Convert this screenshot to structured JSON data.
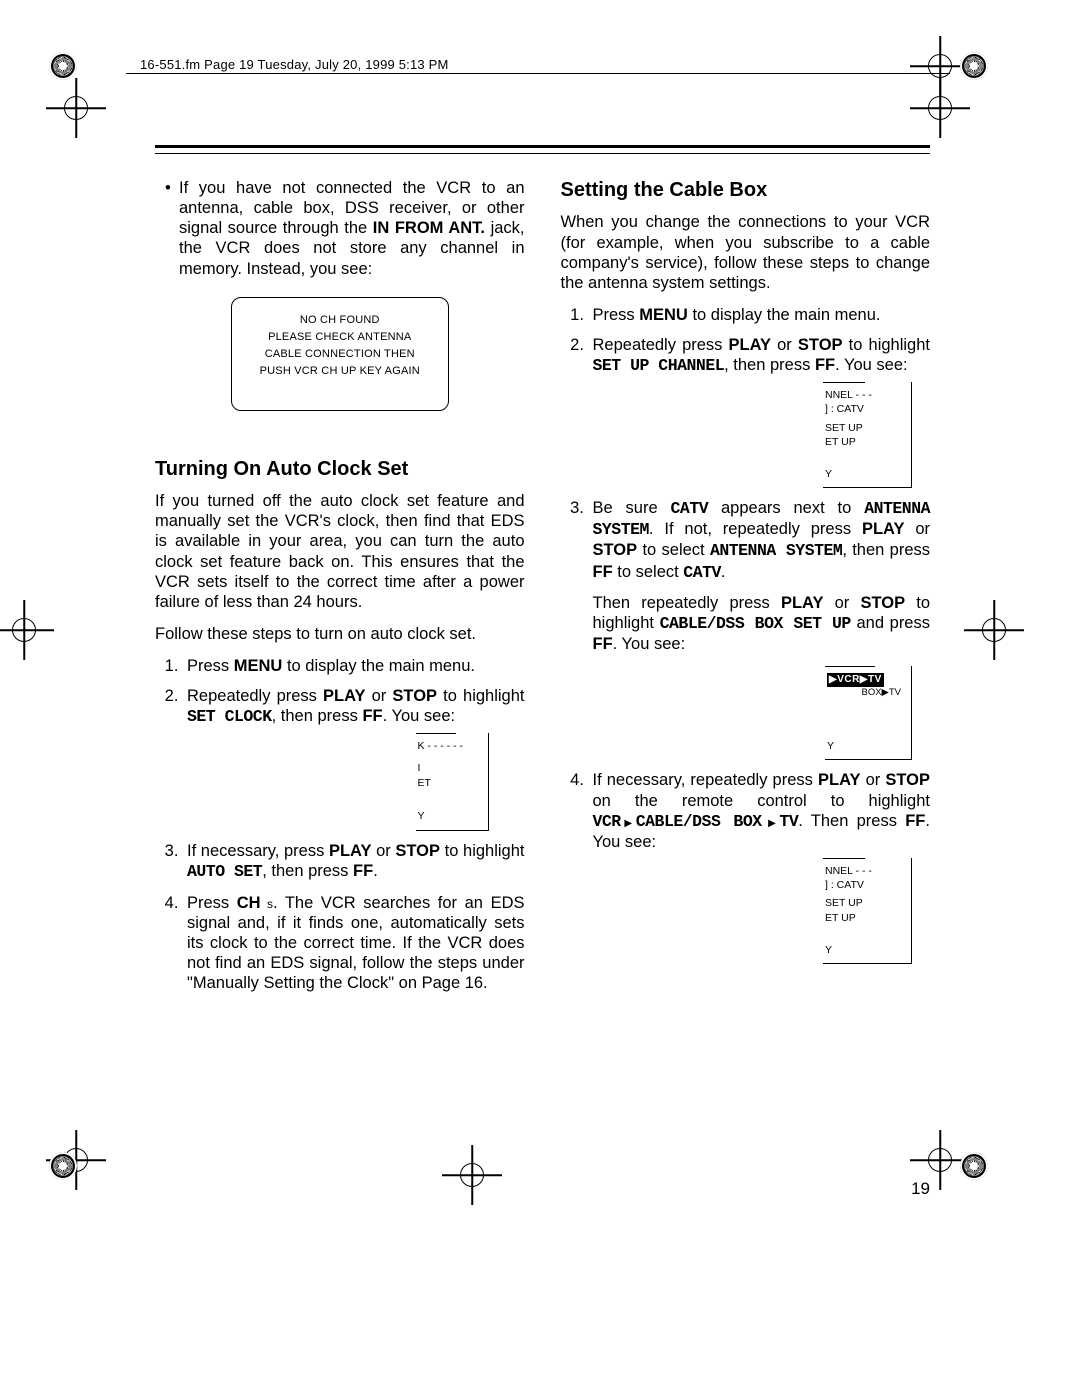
{
  "header": "16-551.fm  Page 19  Tuesday, July 20, 1999  5:13 PM",
  "page_number": "19",
  "left": {
    "bullet": {
      "pre": "If you have not connected the VCR to an antenna, cable box, DSS receiver, or other signal source through the ",
      "kw1": "IN FROM ANT.",
      "post": " jack, the VCR does not store any channel in memory. Instead, you see:"
    },
    "msgbox": {
      "l1": "NO CH FOUND",
      "l2": "PLEASE CHECK ANTENNA",
      "l3": "CABLE CONNECTION THEN",
      "l4": "PUSH VCR CH UP KEY AGAIN"
    },
    "h": "Turning On Auto Clock Set",
    "p1": "If you turned off the auto clock set feature and manually set the VCR's clock, then find that EDS is available in your area, you can turn the auto clock set feature back on. This ensures that the VCR sets itself to the correct time after a power failure of less than 24 hours.",
    "p2": "Follow these steps to turn on auto clock set.",
    "s1a": "Press ",
    "s1b": "MENU",
    "s1c": " to display the main menu.",
    "s2a": "Repeatedly press ",
    "s2b": "PLAY",
    "s2c": " or ",
    "s2d": "STOP",
    "s2e": " to highlight ",
    "s2f": "SET CLOCK",
    "s2g": ", then press ",
    "s2h": "FF",
    "s2i": ". You see:",
    "screen1": {
      "l1": "K  - - - - - -",
      "l2": "I",
      "l3": "ET",
      "l4": "Y"
    },
    "s3a": "If necessary, press ",
    "s3b": "PLAY",
    "s3c": " or ",
    "s3d": "STOP",
    "s3e": " to highlight ",
    "s3f": "AUTO SET",
    "s3g": ", then press ",
    "s3h": "FF",
    "s3i": ".",
    "s4a": "Press ",
    "s4b": "CH",
    "s4c": " s",
    "s4d": ". The VCR searches for an EDS signal and, if it finds one, automatically sets its clock to the correct time. If the VCR does not find an EDS signal, follow the steps under \"Manually Setting the Clock\" on Page 16."
  },
  "right": {
    "h": "Setting the Cable Box",
    "p1": "When you change the connections to your VCR (for example, when you subscribe to a cable company's service), follow these steps to change the antenna system settings.",
    "s1a": "Press ",
    "s1b": "MENU",
    "s1c": " to display the main menu.",
    "s2a": "Repeatedly press ",
    "s2b": "PLAY",
    "s2c": " or ",
    "s2d": "STOP",
    "s2e": " to highlight ",
    "s2f": "SET UP CHANNEL",
    "s2g": ", then press ",
    "s2h": "FF",
    "s2i": ". You see:",
    "screenA": {
      "l1": "NNEL  - - -",
      "l2": "]  :  CATV",
      "l3": "SET UP",
      "l4": "ET UP",
      "l5": "Y"
    },
    "s3a": "Be sure ",
    "s3b": "CATV",
    "s3c": " appears next to ",
    "s3d": "ANTENNA SYSTEM",
    "s3e": ". If not, repeatedly press ",
    "s3f": "PLAY",
    "s3g": " or ",
    "s3h": "STOP",
    "s3i": " to select ",
    "s3j": "ANTENNA  SYSTEM",
    "s3k": ", then press ",
    "s3l": "FF",
    "s3m": " to select ",
    "s3n": "CATV",
    "s3o": ".",
    "s3pA": "Then repeatedly press ",
    "s3pB": "PLAY",
    "s3pC": " or ",
    "s3pD": "STOP",
    "s3pE": " to highlight ",
    "s3pF": "CABLE/DSS BOX SET UP",
    "s3pG": " and press ",
    "s3pH": "FF",
    "s3pI": ". You see:",
    "screenB": {
      "l1": "▶VCR▶TV",
      "l2": "BOX▶TV",
      "l3": "Y"
    },
    "s4a": "If necessary, repeatedly press ",
    "s4b": "PLAY",
    "s4c": " or ",
    "s4d": "STOP",
    "s4e": " on the remote control to highlight ",
    "s4f1": "VCR",
    "s4f2": "CABLE/DSS BOX",
    "s4f3": "TV",
    "s4g": ". Then press ",
    "s4h": "FF",
    "s4i": ". You see:",
    "screenC": {
      "l1": "NNEL  - - -",
      "l2": "]  :  CATV",
      "l3": "SET UP",
      "l4": "ET UP",
      "l5": "Y"
    }
  }
}
